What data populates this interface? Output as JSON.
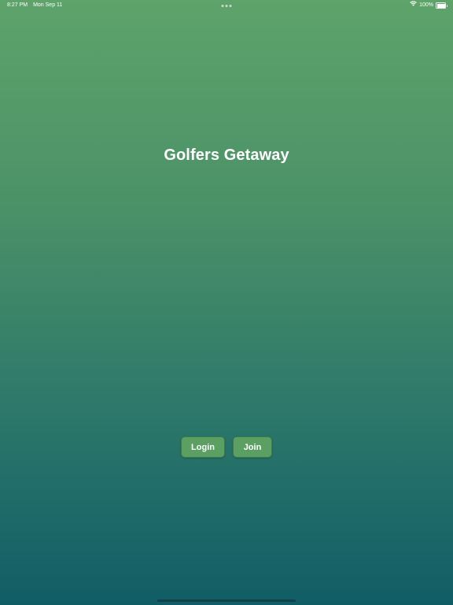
{
  "status_bar": {
    "time": "8:27 PM",
    "date": "Mon Sep 11",
    "battery_percent": "100%",
    "battery_level": 1.0
  },
  "app": {
    "title": "Golfers Getaway"
  },
  "actions": {
    "login_label": "Login",
    "join_label": "Join"
  },
  "colors": {
    "gradient_top": "#5ea36a",
    "gradient_bottom": "#115d66",
    "button_fill": "#5b9f63",
    "text": "#ffffff"
  },
  "icons": [
    "wifi-icon",
    "battery-icon",
    "multitasking-dots-icon"
  ]
}
